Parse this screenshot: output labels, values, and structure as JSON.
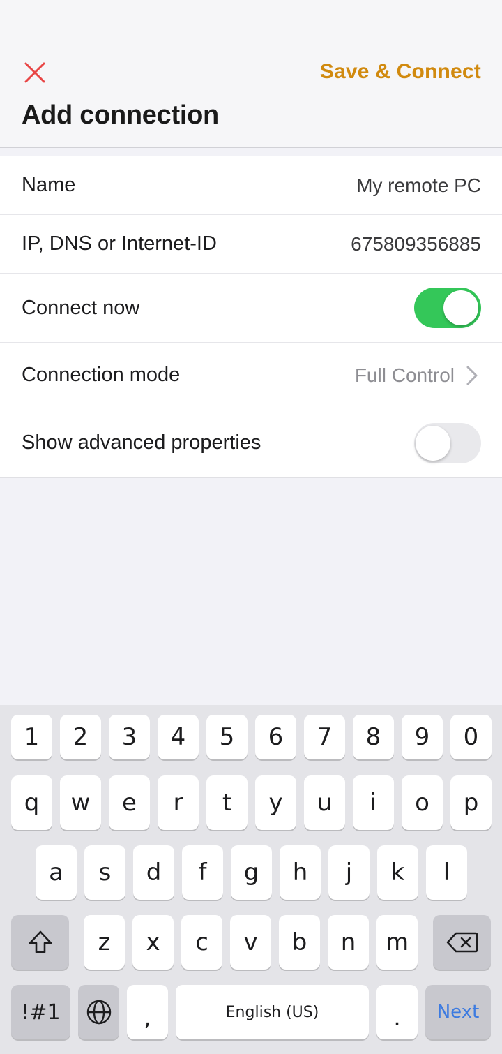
{
  "colors": {
    "accent": "#d18a0f",
    "close": "#e84545",
    "toggle_on": "#34c759",
    "next": "#3d7be0"
  },
  "header": {
    "close_icon": "close-icon",
    "save_label": "Save & Connect",
    "title": "Add connection"
  },
  "settings": {
    "name": {
      "label": "Name",
      "value": "My remote PC"
    },
    "address": {
      "label": "IP, DNS or Internet-ID",
      "value": "675809356885"
    },
    "connect_now": {
      "label": "Connect now",
      "enabled": true
    },
    "mode": {
      "label": "Connection mode",
      "value": "Full Control",
      "icon": "chevron-right-icon"
    },
    "advanced": {
      "label": "Show advanced properties",
      "enabled": false
    }
  },
  "keyboard": {
    "numbers": [
      "1",
      "2",
      "3",
      "4",
      "5",
      "6",
      "7",
      "8",
      "9",
      "0"
    ],
    "row1": [
      "q",
      "w",
      "e",
      "r",
      "t",
      "y",
      "u",
      "i",
      "o",
      "p"
    ],
    "row2": [
      "a",
      "s",
      "d",
      "f",
      "g",
      "h",
      "j",
      "k",
      "l"
    ],
    "row3": [
      "z",
      "x",
      "c",
      "v",
      "b",
      "n",
      "m"
    ],
    "shift_icon": "shift-icon",
    "backspace_icon": "backspace-icon",
    "symbols_label": "!#1",
    "globe_icon": "globe-icon",
    "comma": ",",
    "space_label": "English (US)",
    "period": ".",
    "next_label": "Next"
  }
}
